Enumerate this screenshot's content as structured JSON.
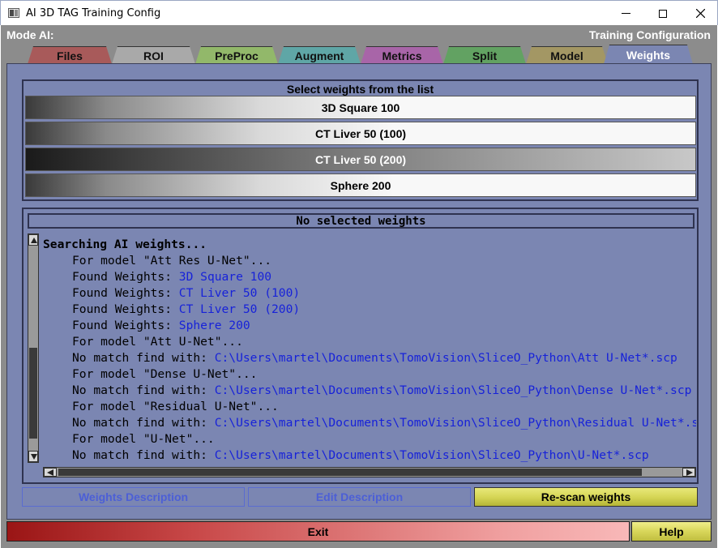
{
  "window": {
    "title": "AI 3D TAG Training Config",
    "controls": {
      "minimize_icon": "minimize-icon",
      "maximize_icon": "maximize-icon",
      "close_icon": "close-icon"
    }
  },
  "header": {
    "mode_label": "Mode AI:",
    "config_label": "Training Configuration"
  },
  "tabs": [
    {
      "label": "Files",
      "color": "#a85a5a",
      "active": false
    },
    {
      "label": "ROI",
      "color": "#a9a9a9",
      "active": false
    },
    {
      "label": "PreProc",
      "color": "#92b86a",
      "active": false
    },
    {
      "label": "Augment",
      "color": "#5fa6a6",
      "active": false
    },
    {
      "label": "Metrics",
      "color": "#a865a8",
      "active": false
    },
    {
      "label": "Split",
      "color": "#62a262",
      "active": false
    },
    {
      "label": "Model",
      "color": "#a39764",
      "active": false
    },
    {
      "label": "Weights",
      "color": "#7b86b2",
      "active": true
    }
  ],
  "weights_list": {
    "title": "Select weights from the list",
    "items": [
      {
        "label": "3D Square 100",
        "selected": false
      },
      {
        "label": "CT Liver 50 (100)",
        "selected": false
      },
      {
        "label": "CT Liver 50 (200)",
        "selected": true
      },
      {
        "label": "Sphere 200",
        "selected": false
      }
    ]
  },
  "log": {
    "header": "No selected weights",
    "lines": [
      {
        "text": "Searching AI weights...",
        "bold": true,
        "indent": false,
        "value": ""
      },
      {
        "text": "For model \"Att Res U-Net\"...",
        "bold": false,
        "indent": true,
        "value": ""
      },
      {
        "text": "Found Weights: ",
        "bold": false,
        "indent": true,
        "value": "3D Square 100"
      },
      {
        "text": "Found Weights: ",
        "bold": false,
        "indent": true,
        "value": "CT Liver 50 (100)"
      },
      {
        "text": "Found Weights: ",
        "bold": false,
        "indent": true,
        "value": "CT Liver 50 (200)"
      },
      {
        "text": "Found Weights: ",
        "bold": false,
        "indent": true,
        "value": "Sphere 200"
      },
      {
        "text": "For model \"Att U-Net\"...",
        "bold": false,
        "indent": true,
        "value": ""
      },
      {
        "text": "No match find with: ",
        "bold": false,
        "indent": true,
        "value": "C:\\Users\\martel\\Documents\\TomoVision\\SliceO_Python\\Att U-Net*.scp"
      },
      {
        "text": "For model \"Dense U-Net\"...",
        "bold": false,
        "indent": true,
        "value": ""
      },
      {
        "text": "No match find with: ",
        "bold": false,
        "indent": true,
        "value": "C:\\Users\\martel\\Documents\\TomoVision\\SliceO_Python\\Dense U-Net*.scp"
      },
      {
        "text": "For model \"Residual U-Net\"...",
        "bold": false,
        "indent": true,
        "value": ""
      },
      {
        "text": "No match find with: ",
        "bold": false,
        "indent": true,
        "value": "C:\\Users\\martel\\Documents\\TomoVision\\SliceO_Python\\Residual U-Net*.scp"
      },
      {
        "text": "For model \"U-Net\"...",
        "bold": false,
        "indent": true,
        "value": ""
      },
      {
        "text": "No match find with: ",
        "bold": false,
        "indent": true,
        "value": "C:\\Users\\martel\\Documents\\TomoVision\\SliceO_Python\\U-Net*.scp"
      }
    ]
  },
  "buttons": {
    "weights_description": "Weights Description",
    "edit_description": "Edit Description",
    "rescan_weights": "Re-scan weights",
    "exit": "Exit",
    "help": "Help"
  },
  "colors": {
    "panel": "#7b86b2",
    "log_value": "#1722d9",
    "disabled_text": "#4c5fd6"
  }
}
